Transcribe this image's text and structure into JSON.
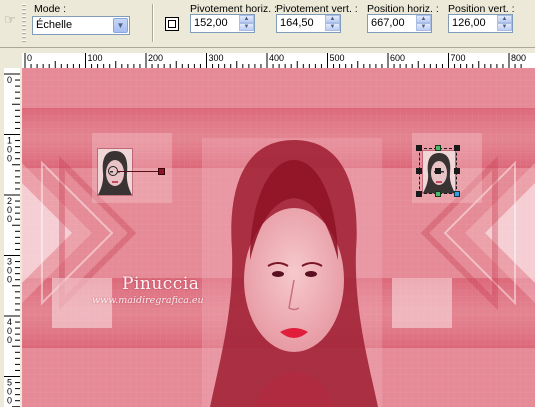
{
  "toolbar": {
    "mode_label": "Mode :",
    "mode_value": "Échelle",
    "fields": [
      {
        "label": "Pivotement horiz. :",
        "value": "152,00"
      },
      {
        "label": "Pivotement vert. :",
        "value": "164,50"
      },
      {
        "label": "Position horiz. :",
        "value": "667,00"
      },
      {
        "label": "Position vert. :",
        "value": "126,00"
      }
    ],
    "icons": {
      "tool": "pick-tool-icon",
      "center": "center-pivot-icon"
    }
  },
  "ruler": {
    "horizontal_labels": [
      "0",
      "100",
      "200",
      "300",
      "400",
      "500",
      "600",
      "700",
      "800"
    ],
    "vertical_labels": [
      "0",
      "1 0 0",
      "2 0 0",
      "3 0 0",
      "4 0 0",
      "5 0 0"
    ]
  },
  "canvas": {
    "watermark_name": "Pinuccia",
    "watermark_url": "www.maidiregrafica.eu",
    "colors": {
      "base": "#e58a96",
      "dark": "#d4485f",
      "light": "#f4c6cc",
      "handle": "#8b1528"
    }
  }
}
